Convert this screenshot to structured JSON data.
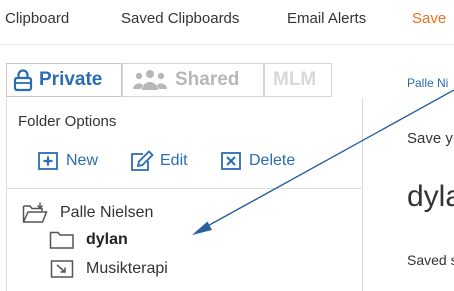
{
  "nav": {
    "tabs": [
      {
        "label": "Clipboard"
      },
      {
        "label": "Saved Clipboards"
      },
      {
        "label": "Email Alerts"
      },
      {
        "label": "Save"
      }
    ]
  },
  "visibility": {
    "private_label": "Private",
    "shared_label": "Shared",
    "mlm_label": "MLM"
  },
  "folder_options": {
    "title": "Folder Options",
    "new_label": "New",
    "edit_label": "Edit",
    "delete_label": "Delete"
  },
  "tree": {
    "root_label": "Palle Nielsen",
    "children": [
      {
        "label": "dylan",
        "icon": "folder-outline-icon",
        "selected": true
      },
      {
        "label": "Musikterapi",
        "icon": "folder-move-icon",
        "selected": false
      }
    ]
  },
  "right_panel": {
    "user_link": "Palle Ni",
    "save_text": "Save y",
    "folder_name": "dyla",
    "saved_text": "Saved s"
  },
  "colors": {
    "accent_blue": "#2a6db3",
    "active_tab_orange": "#e8721c",
    "arrow_blue": "#2a5f9e"
  }
}
